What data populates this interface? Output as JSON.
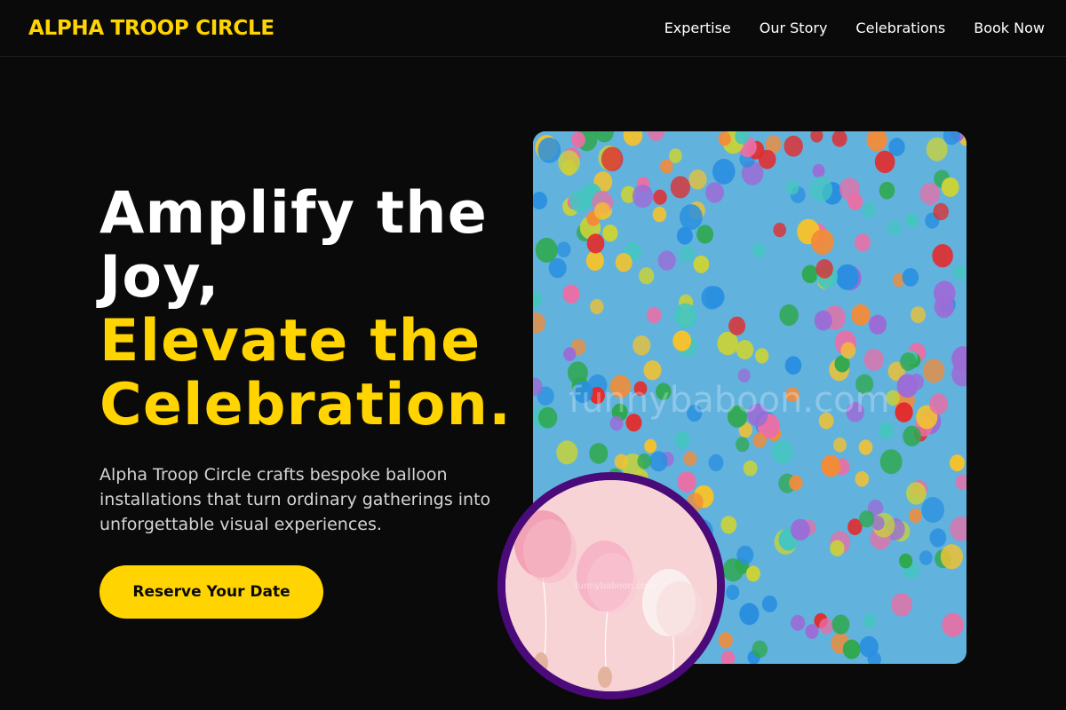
{
  "brand": {
    "name": "ALPHA TROOP CIRCLE",
    "color": "#ffd400"
  },
  "nav": {
    "items": [
      {
        "label": "Expertise"
      },
      {
        "label": "Our Story"
      },
      {
        "label": "Celebrations"
      },
      {
        "label": "Book Now"
      }
    ]
  },
  "hero": {
    "headline_white_1": "Amplify the",
    "headline_white_2": "Joy,",
    "headline_yellow_1": "Elevate the",
    "headline_yellow_2": "Celebration.",
    "description": "Alpha Troop Circle crafts bespoke balloon installations that turn ordinary gatherings into unforgettable visual experiences.",
    "cta_label": "Reserve Your Date"
  },
  "images": {
    "main_watermark": "funnybaboon.com",
    "inset_watermark": "funnybaboon.com"
  },
  "colors": {
    "background": "#0a0a0a",
    "accent": "#ffd400",
    "inset_border": "#4b0a7a",
    "sky": "#5fb0dc",
    "inset_bg": "#f8d3d6"
  }
}
